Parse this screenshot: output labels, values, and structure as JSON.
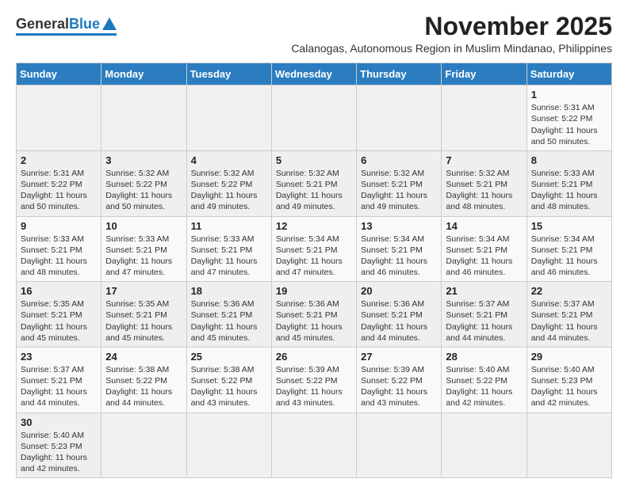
{
  "header": {
    "logo_general": "General",
    "logo_blue": "Blue",
    "month_year": "November 2025",
    "location": "Calanogas, Autonomous Region in Muslim Mindanao, Philippines"
  },
  "weekdays": [
    "Sunday",
    "Monday",
    "Tuesday",
    "Wednesday",
    "Thursday",
    "Friday",
    "Saturday"
  ],
  "weeks": [
    [
      {
        "day": "",
        "info": ""
      },
      {
        "day": "",
        "info": ""
      },
      {
        "day": "",
        "info": ""
      },
      {
        "day": "",
        "info": ""
      },
      {
        "day": "",
        "info": ""
      },
      {
        "day": "",
        "info": ""
      },
      {
        "day": "1",
        "info": "Sunrise: 5:31 AM\nSunset: 5:22 PM\nDaylight: 11 hours\nand 50 minutes."
      }
    ],
    [
      {
        "day": "2",
        "info": "Sunrise: 5:31 AM\nSunset: 5:22 PM\nDaylight: 11 hours\nand 50 minutes."
      },
      {
        "day": "3",
        "info": "Sunrise: 5:32 AM\nSunset: 5:22 PM\nDaylight: 11 hours\nand 50 minutes."
      },
      {
        "day": "4",
        "info": "Sunrise: 5:32 AM\nSunset: 5:22 PM\nDaylight: 11 hours\nand 49 minutes."
      },
      {
        "day": "5",
        "info": "Sunrise: 5:32 AM\nSunset: 5:21 PM\nDaylight: 11 hours\nand 49 minutes."
      },
      {
        "day": "6",
        "info": "Sunrise: 5:32 AM\nSunset: 5:21 PM\nDaylight: 11 hours\nand 49 minutes."
      },
      {
        "day": "7",
        "info": "Sunrise: 5:32 AM\nSunset: 5:21 PM\nDaylight: 11 hours\nand 48 minutes."
      },
      {
        "day": "8",
        "info": "Sunrise: 5:33 AM\nSunset: 5:21 PM\nDaylight: 11 hours\nand 48 minutes."
      }
    ],
    [
      {
        "day": "9",
        "info": "Sunrise: 5:33 AM\nSunset: 5:21 PM\nDaylight: 11 hours\nand 48 minutes."
      },
      {
        "day": "10",
        "info": "Sunrise: 5:33 AM\nSunset: 5:21 PM\nDaylight: 11 hours\nand 47 minutes."
      },
      {
        "day": "11",
        "info": "Sunrise: 5:33 AM\nSunset: 5:21 PM\nDaylight: 11 hours\nand 47 minutes."
      },
      {
        "day": "12",
        "info": "Sunrise: 5:34 AM\nSunset: 5:21 PM\nDaylight: 11 hours\nand 47 minutes."
      },
      {
        "day": "13",
        "info": "Sunrise: 5:34 AM\nSunset: 5:21 PM\nDaylight: 11 hours\nand 46 minutes."
      },
      {
        "day": "14",
        "info": "Sunrise: 5:34 AM\nSunset: 5:21 PM\nDaylight: 11 hours\nand 46 minutes."
      },
      {
        "day": "15",
        "info": "Sunrise: 5:34 AM\nSunset: 5:21 PM\nDaylight: 11 hours\nand 46 minutes."
      }
    ],
    [
      {
        "day": "16",
        "info": "Sunrise: 5:35 AM\nSunset: 5:21 PM\nDaylight: 11 hours\nand 45 minutes."
      },
      {
        "day": "17",
        "info": "Sunrise: 5:35 AM\nSunset: 5:21 PM\nDaylight: 11 hours\nand 45 minutes."
      },
      {
        "day": "18",
        "info": "Sunrise: 5:36 AM\nSunset: 5:21 PM\nDaylight: 11 hours\nand 45 minutes."
      },
      {
        "day": "19",
        "info": "Sunrise: 5:36 AM\nSunset: 5:21 PM\nDaylight: 11 hours\nand 45 minutes."
      },
      {
        "day": "20",
        "info": "Sunrise: 5:36 AM\nSunset: 5:21 PM\nDaylight: 11 hours\nand 44 minutes."
      },
      {
        "day": "21",
        "info": "Sunrise: 5:37 AM\nSunset: 5:21 PM\nDaylight: 11 hours\nand 44 minutes."
      },
      {
        "day": "22",
        "info": "Sunrise: 5:37 AM\nSunset: 5:21 PM\nDaylight: 11 hours\nand 44 minutes."
      }
    ],
    [
      {
        "day": "23",
        "info": "Sunrise: 5:37 AM\nSunset: 5:21 PM\nDaylight: 11 hours\nand 44 minutes."
      },
      {
        "day": "24",
        "info": "Sunrise: 5:38 AM\nSunset: 5:22 PM\nDaylight: 11 hours\nand 44 minutes."
      },
      {
        "day": "25",
        "info": "Sunrise: 5:38 AM\nSunset: 5:22 PM\nDaylight: 11 hours\nand 43 minutes."
      },
      {
        "day": "26",
        "info": "Sunrise: 5:39 AM\nSunset: 5:22 PM\nDaylight: 11 hours\nand 43 minutes."
      },
      {
        "day": "27",
        "info": "Sunrise: 5:39 AM\nSunset: 5:22 PM\nDaylight: 11 hours\nand 43 minutes."
      },
      {
        "day": "28",
        "info": "Sunrise: 5:40 AM\nSunset: 5:22 PM\nDaylight: 11 hours\nand 42 minutes."
      },
      {
        "day": "29",
        "info": "Sunrise: 5:40 AM\nSunset: 5:23 PM\nDaylight: 11 hours\nand 42 minutes."
      }
    ],
    [
      {
        "day": "30",
        "info": "Sunrise: 5:40 AM\nSunset: 5:23 PM\nDaylight: 11 hours\nand 42 minutes."
      },
      {
        "day": "",
        "info": ""
      },
      {
        "day": "",
        "info": ""
      },
      {
        "day": "",
        "info": ""
      },
      {
        "day": "",
        "info": ""
      },
      {
        "day": "",
        "info": ""
      },
      {
        "day": "",
        "info": ""
      }
    ]
  ]
}
